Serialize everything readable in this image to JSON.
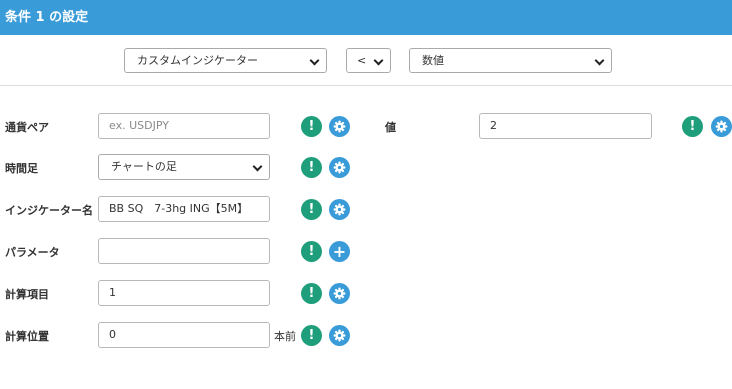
{
  "header": {
    "title": "条件 1 の設定"
  },
  "condition": {
    "indicator_type": "カスタムインジケーター",
    "operator": "<",
    "value_type": "数値"
  },
  "form": {
    "pair": {
      "label": "通貨ペア",
      "placeholder": "ex. USDJPY",
      "value": ""
    },
    "timeframe": {
      "label": "時間足",
      "value": "チャートの足"
    },
    "indicator": {
      "label": "インジケーター名",
      "value": "BB SQ　7-3hg ING【5M】"
    },
    "params": {
      "label": "パラメータ",
      "value": ""
    },
    "calc_item": {
      "label": "計算項目",
      "value": "1"
    },
    "calc_pos": {
      "label": "計算位置",
      "value": "0",
      "suffix": "本前"
    },
    "value_field": {
      "label": "値",
      "value": "2"
    }
  },
  "icons": {
    "info": "exclamation-icon",
    "settings": "gear-icon",
    "add": "plus-icon",
    "info_glyph": "!",
    "add_glyph": "+"
  },
  "colors": {
    "header_bg": "#3a9bd9",
    "info_green": "#1e9e7a",
    "settings_blue": "#3a9bd9"
  }
}
